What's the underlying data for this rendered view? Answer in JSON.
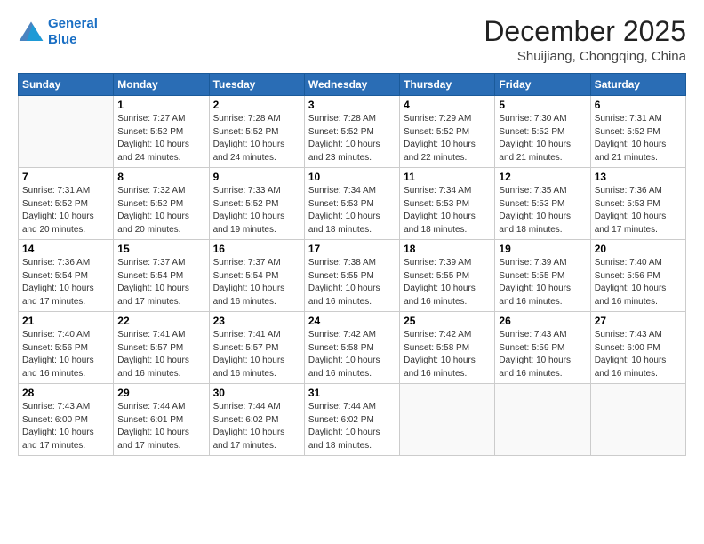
{
  "logo": {
    "line1": "General",
    "line2": "Blue"
  },
  "header": {
    "month": "December 2025",
    "location": "Shuijiang, Chongqing, China"
  },
  "weekdays": [
    "Sunday",
    "Monday",
    "Tuesday",
    "Wednesday",
    "Thursday",
    "Friday",
    "Saturday"
  ],
  "weeks": [
    [
      {
        "day": "",
        "info": ""
      },
      {
        "day": "1",
        "info": "Sunrise: 7:27 AM\nSunset: 5:52 PM\nDaylight: 10 hours\nand 24 minutes."
      },
      {
        "day": "2",
        "info": "Sunrise: 7:28 AM\nSunset: 5:52 PM\nDaylight: 10 hours\nand 24 minutes."
      },
      {
        "day": "3",
        "info": "Sunrise: 7:28 AM\nSunset: 5:52 PM\nDaylight: 10 hours\nand 23 minutes."
      },
      {
        "day": "4",
        "info": "Sunrise: 7:29 AM\nSunset: 5:52 PM\nDaylight: 10 hours\nand 22 minutes."
      },
      {
        "day": "5",
        "info": "Sunrise: 7:30 AM\nSunset: 5:52 PM\nDaylight: 10 hours\nand 21 minutes."
      },
      {
        "day": "6",
        "info": "Sunrise: 7:31 AM\nSunset: 5:52 PM\nDaylight: 10 hours\nand 21 minutes."
      }
    ],
    [
      {
        "day": "7",
        "info": "Sunrise: 7:31 AM\nSunset: 5:52 PM\nDaylight: 10 hours\nand 20 minutes."
      },
      {
        "day": "8",
        "info": "Sunrise: 7:32 AM\nSunset: 5:52 PM\nDaylight: 10 hours\nand 20 minutes."
      },
      {
        "day": "9",
        "info": "Sunrise: 7:33 AM\nSunset: 5:52 PM\nDaylight: 10 hours\nand 19 minutes."
      },
      {
        "day": "10",
        "info": "Sunrise: 7:34 AM\nSunset: 5:53 PM\nDaylight: 10 hours\nand 18 minutes."
      },
      {
        "day": "11",
        "info": "Sunrise: 7:34 AM\nSunset: 5:53 PM\nDaylight: 10 hours\nand 18 minutes."
      },
      {
        "day": "12",
        "info": "Sunrise: 7:35 AM\nSunset: 5:53 PM\nDaylight: 10 hours\nand 18 minutes."
      },
      {
        "day": "13",
        "info": "Sunrise: 7:36 AM\nSunset: 5:53 PM\nDaylight: 10 hours\nand 17 minutes."
      }
    ],
    [
      {
        "day": "14",
        "info": "Sunrise: 7:36 AM\nSunset: 5:54 PM\nDaylight: 10 hours\nand 17 minutes."
      },
      {
        "day": "15",
        "info": "Sunrise: 7:37 AM\nSunset: 5:54 PM\nDaylight: 10 hours\nand 17 minutes."
      },
      {
        "day": "16",
        "info": "Sunrise: 7:37 AM\nSunset: 5:54 PM\nDaylight: 10 hours\nand 16 minutes."
      },
      {
        "day": "17",
        "info": "Sunrise: 7:38 AM\nSunset: 5:55 PM\nDaylight: 10 hours\nand 16 minutes."
      },
      {
        "day": "18",
        "info": "Sunrise: 7:39 AM\nSunset: 5:55 PM\nDaylight: 10 hours\nand 16 minutes."
      },
      {
        "day": "19",
        "info": "Sunrise: 7:39 AM\nSunset: 5:55 PM\nDaylight: 10 hours\nand 16 minutes."
      },
      {
        "day": "20",
        "info": "Sunrise: 7:40 AM\nSunset: 5:56 PM\nDaylight: 10 hours\nand 16 minutes."
      }
    ],
    [
      {
        "day": "21",
        "info": "Sunrise: 7:40 AM\nSunset: 5:56 PM\nDaylight: 10 hours\nand 16 minutes."
      },
      {
        "day": "22",
        "info": "Sunrise: 7:41 AM\nSunset: 5:57 PM\nDaylight: 10 hours\nand 16 minutes."
      },
      {
        "day": "23",
        "info": "Sunrise: 7:41 AM\nSunset: 5:57 PM\nDaylight: 10 hours\nand 16 minutes."
      },
      {
        "day": "24",
        "info": "Sunrise: 7:42 AM\nSunset: 5:58 PM\nDaylight: 10 hours\nand 16 minutes."
      },
      {
        "day": "25",
        "info": "Sunrise: 7:42 AM\nSunset: 5:58 PM\nDaylight: 10 hours\nand 16 minutes."
      },
      {
        "day": "26",
        "info": "Sunrise: 7:43 AM\nSunset: 5:59 PM\nDaylight: 10 hours\nand 16 minutes."
      },
      {
        "day": "27",
        "info": "Sunrise: 7:43 AM\nSunset: 6:00 PM\nDaylight: 10 hours\nand 16 minutes."
      }
    ],
    [
      {
        "day": "28",
        "info": "Sunrise: 7:43 AM\nSunset: 6:00 PM\nDaylight: 10 hours\nand 17 minutes."
      },
      {
        "day": "29",
        "info": "Sunrise: 7:44 AM\nSunset: 6:01 PM\nDaylight: 10 hours\nand 17 minutes."
      },
      {
        "day": "30",
        "info": "Sunrise: 7:44 AM\nSunset: 6:02 PM\nDaylight: 10 hours\nand 17 minutes."
      },
      {
        "day": "31",
        "info": "Sunrise: 7:44 AM\nSunset: 6:02 PM\nDaylight: 10 hours\nand 18 minutes."
      },
      {
        "day": "",
        "info": ""
      },
      {
        "day": "",
        "info": ""
      },
      {
        "day": "",
        "info": ""
      }
    ]
  ]
}
